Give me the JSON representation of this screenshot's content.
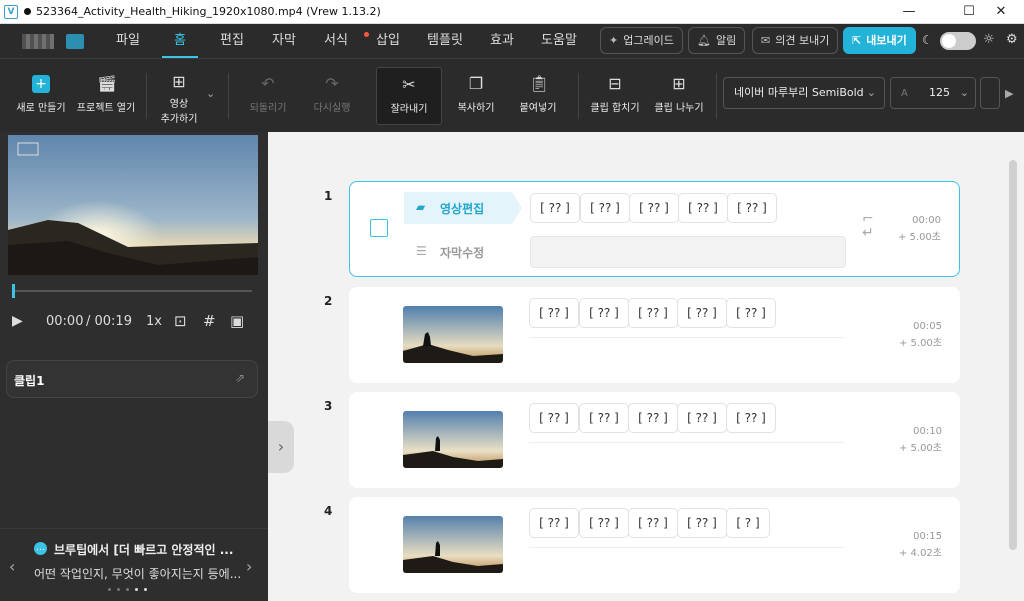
{
  "window": {
    "title": "523364_Activity_Health_Hiking_1920x1080.mp4 (Vrew 1.13.2)",
    "app_icon": "V",
    "minimize": "—",
    "maximize": "☐",
    "close": "✕"
  },
  "menu": {
    "items": [
      "파일",
      "홈",
      "편집",
      "자막",
      "서식",
      "삽입",
      "템플릿",
      "효과",
      "도움말"
    ],
    "active": "홈",
    "upgrade": "업그레이드",
    "alarm": "알림",
    "feedback": "의견 보내기",
    "export": "내보내기"
  },
  "toolbar": {
    "new": "새로 만들기",
    "open": "프로젝트 열기",
    "add_video_line1": "영상",
    "add_video_line2": "추가하기",
    "undo": "되돌리기",
    "redo": "다시실행",
    "cut": "잘라내기",
    "copy": "복사하기",
    "paste": "붙여넣기",
    "merge": "클립 합치기",
    "split": "클립 나누기",
    "font": "네이버 마루부리 SemiBold",
    "font_size": "125"
  },
  "player": {
    "current_time": "00:00",
    "total_time": "/ 00:19",
    "speed": "1x",
    "progress": 0.0
  },
  "clip_card": {
    "label": "클립1"
  },
  "banner": {
    "title": "브루팁에서 [더 빠르고 안정적인 ...",
    "body": "어떤 작업인지, 무엇이 좋아지는지 등에...",
    "prev": "‹",
    "next": "›"
  },
  "clips": [
    {
      "number": "1",
      "words": [
        "[ ?? ]",
        "[ ?? ]",
        "[ ?? ]",
        "[ ?? ]",
        "[ ?? ]"
      ],
      "start": "00:00",
      "duration": "+  5.00초",
      "tab_video": "영상편집",
      "tab_subtitle": "자막수정"
    },
    {
      "number": "2",
      "words": [
        "[ ?? ]",
        "[ ?? ]",
        "[ ?? ]",
        "[ ?? ]",
        "[ ?? ]"
      ],
      "start": "00:05",
      "duration": "+  5.00초"
    },
    {
      "number": "3",
      "words": [
        "[ ?? ]",
        "[ ?? ]",
        "[ ?? ]",
        "[ ?? ]",
        "[ ?? ]"
      ],
      "start": "00:10",
      "duration": "+  5.00초"
    },
    {
      "number": "4",
      "words": [
        "[ ?? ]",
        "[ ?? ]",
        "[ ?? ]",
        "[ ?? ]",
        "[ ? ]"
      ],
      "start": "00:15",
      "duration": "+  4.02초"
    }
  ],
  "colors": {
    "accent": "#3cc4e6",
    "dark_bg": "#2b2b2b",
    "export_bg": "#23b3d9"
  }
}
